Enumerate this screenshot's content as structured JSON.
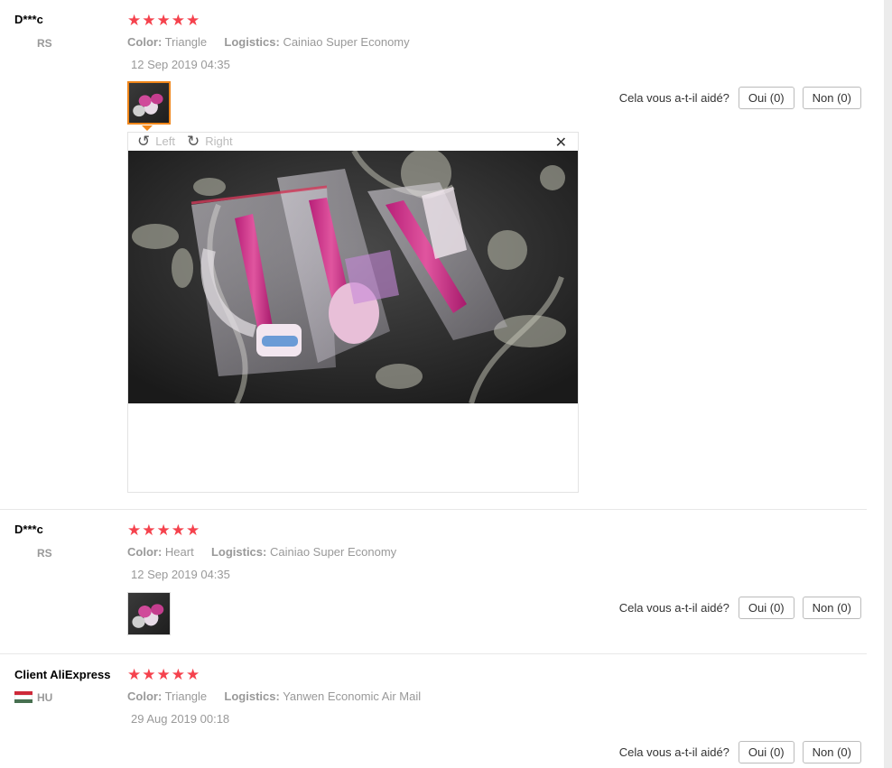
{
  "reviews": [
    {
      "user": "D***c",
      "country": "RS",
      "stars": "★★★★★",
      "color_label": "Color:",
      "color_value": "Triangle",
      "logistics_label": "Logistics:",
      "logistics_value": "Cainiao Super Economy",
      "date": "12 Sep 2019 04:35",
      "helpful": {
        "question": "Cela vous a-t-il aidé?",
        "yes": "Oui (0)",
        "no": "Non (0)"
      }
    },
    {
      "user": "D***c",
      "country": "RS",
      "stars": "★★★★★",
      "color_label": "Color:",
      "color_value": "Heart",
      "logistics_label": "Logistics:",
      "logistics_value": "Cainiao Super Economy",
      "date": "12 Sep 2019 04:35",
      "helpful": {
        "question": "Cela vous a-t-il aidé?",
        "yes": "Oui (0)",
        "no": "Non (0)"
      }
    },
    {
      "user": "Client AliExpress",
      "country": "HU",
      "stars": "★★★★★",
      "color_label": "Color:",
      "color_value": "Triangle",
      "logistics_label": "Logistics:",
      "logistics_value": "Yanwen Economic Air Mail",
      "date": "29 Aug 2019 00:18",
      "helpful": {
        "question": "Cela vous a-t-il aidé?",
        "yes": "Oui (0)",
        "no": "Non (0)"
      }
    }
  ],
  "viewer": {
    "rotate_left": "Left",
    "rotate_right": "Right",
    "rotate_left_icon": "rotate-left-icon",
    "rotate_right_icon": "rotate-right-icon",
    "close_icon": "close-icon"
  },
  "colors": {
    "star": "#f5424d",
    "active_thumb": "#f0861a",
    "hu_flag": [
      "#ce2939",
      "#ffffff",
      "#477050"
    ]
  }
}
